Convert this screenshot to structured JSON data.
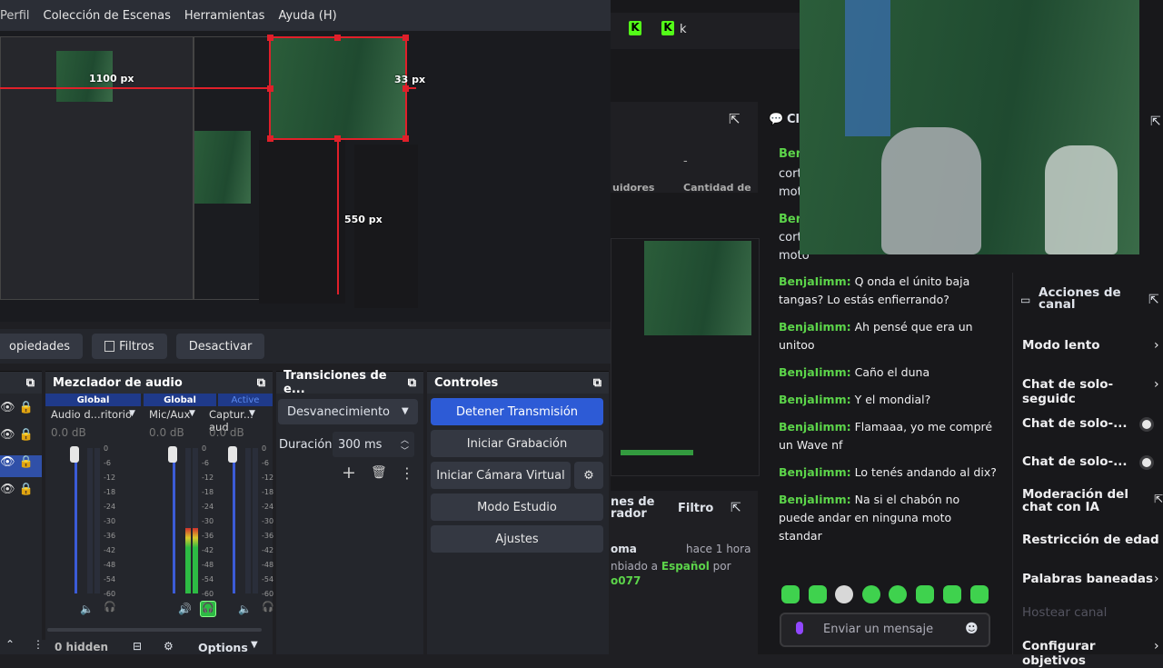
{
  "menu": {
    "items": [
      "Perfil",
      "Colección de Escenas",
      "Herramientas",
      "Ayuda (H)"
    ]
  },
  "preview": {
    "width_label": "1100 px",
    "right_label": "33 px",
    "bottom_label": "550 px"
  },
  "toolbar": {
    "properties": "opiedades",
    "filters": "Filtros",
    "deactivate": "Desactivar"
  },
  "mixer": {
    "title": "Mezclador de audio",
    "tab_global_1": "Global",
    "tab_global_2": "Global",
    "tab_active": "Active",
    "channels": [
      {
        "name": "Audio d...ritorio",
        "db": "0.0 dB"
      },
      {
        "name": "Mic/Aux",
        "db": "0.0 dB"
      },
      {
        "name": "Captur... aud",
        "db": "0.0 dB"
      }
    ],
    "ticks": [
      "0",
      "-6",
      "-12",
      "-18",
      "-24",
      "-30",
      "-36",
      "-42",
      "-48",
      "-54",
      "-60"
    ],
    "levels": [
      0.0,
      0.45,
      0.0
    ],
    "hidden_label": "0 hidden",
    "options_label": "Options"
  },
  "transitions": {
    "title": "Transiciones de e...",
    "selected": "Desvanecimiento",
    "duration_label": "Duración",
    "duration_value": "300 ms"
  },
  "controls": {
    "title": "Controles",
    "stop_stream": "Detener Transmisión",
    "start_record": "Iniciar Grabación",
    "virtual_cam": "Iniciar Cámara Virtual",
    "studio_mode": "Modo Estudio",
    "settings": "Ajustes"
  },
  "twitch": {
    "top_letter": "k",
    "chat_header": "Cl",
    "partial_user": "Ben",
    "partial_lines": [
      "cort",
      "mot",
      "Ben",
      "cort",
      "moto"
    ],
    "partial_stats_1": "uidores",
    "partial_stats_2": "Cantidad de",
    "left_section": "nes de\nrador",
    "filter": "Filtro",
    "activity_user": "oma",
    "activity_time": "hace 1 hora",
    "activity_text_pre": "nbiado a",
    "activity_lang": "Español",
    "activity_by": "por",
    "activity_user2": "o077",
    "messages": [
      {
        "user": "BenjaIimm:",
        "text": "Q onda el únito baja tangas? Lo estás enfierrando?"
      },
      {
        "user": "BenjaIimm:",
        "text": "Ah pensé que era un unitoo"
      },
      {
        "user": "BenjaIimm:",
        "text": "Caño el duna"
      },
      {
        "user": "BenjaIimm:",
        "text": "Y el mondial?"
      },
      {
        "user": "BenjaIimm:",
        "text": "Flamaaa, yo me compré un Wave nf"
      },
      {
        "user": "BenjaIimm:",
        "text": "Lo tenés andando al dix?"
      },
      {
        "user": "BenjaIimm:",
        "text": "Na si el chabón no puede andar en ninguna moto standar"
      }
    ],
    "chat_placeholder": "Enviar un mensaje",
    "actions_title": "Acciones de canal",
    "actions": [
      {
        "label": "Modo lento",
        "kind": "chevron"
      },
      {
        "label": "Chat de solo-seguidc",
        "kind": "chevron"
      },
      {
        "label": "Chat de solo-...",
        "kind": "toggle"
      },
      {
        "label": "Chat de solo-...",
        "kind": "toggle"
      },
      {
        "label": "Moderación del chat con IA",
        "kind": "link"
      },
      {
        "label": "Restricción de edad",
        "kind": "chevron"
      },
      {
        "label": "Palabras baneadas",
        "kind": "chevron"
      },
      {
        "label": "Hostear canal",
        "kind": "disabled"
      },
      {
        "label": "Configurar objetivos",
        "kind": "chevron"
      }
    ]
  },
  "colors": {
    "accent_blue": "#2d5bd6",
    "twitch_green": "#5cd44a",
    "selection_red": "#e0202a"
  }
}
